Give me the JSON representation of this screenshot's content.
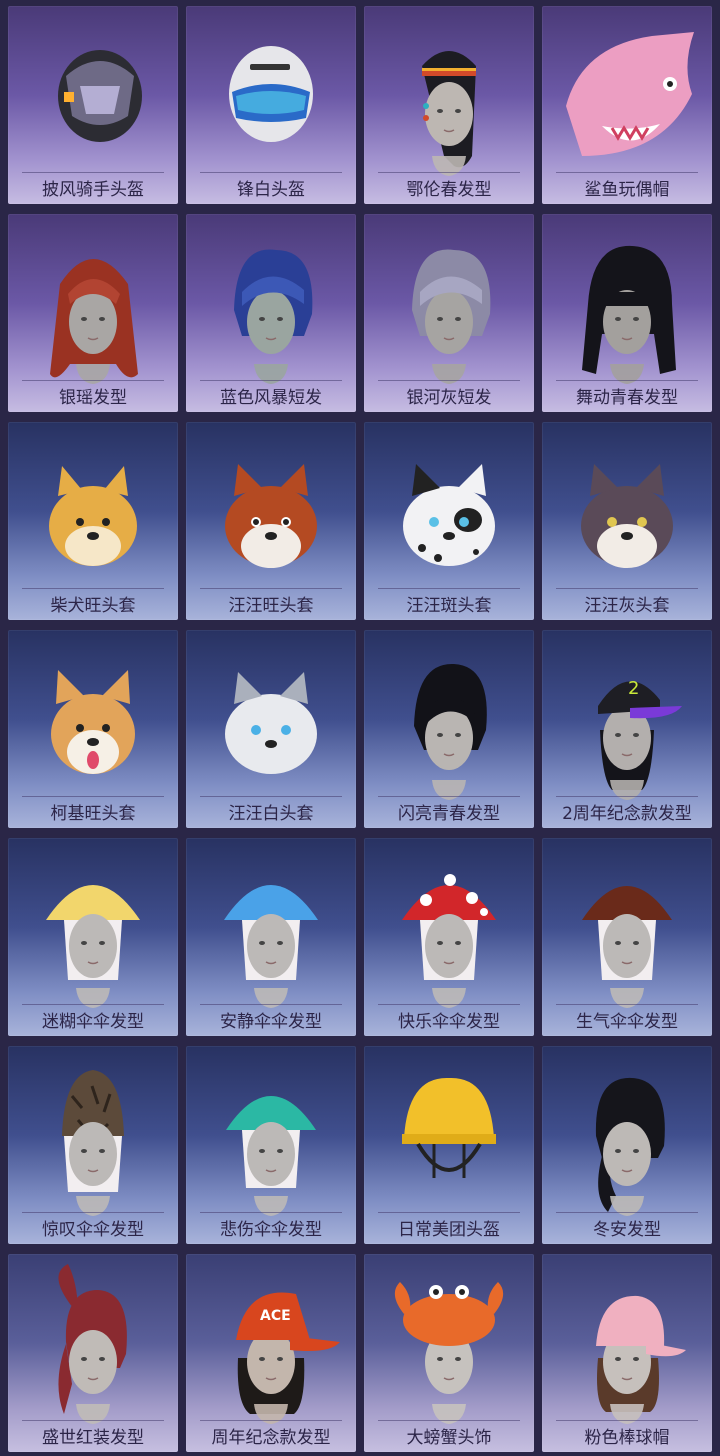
{
  "items": [
    {
      "name": "披风骑手头盔",
      "kind": "helmet-dark",
      "bg": "purple"
    },
    {
      "name": "锋白头盔",
      "kind": "helmet-white",
      "bg": "purple"
    },
    {
      "name": "鄂伦春发型",
      "kind": "hair-braid",
      "bg": "purple"
    },
    {
      "name": "鲨鱼玩偶帽",
      "kind": "shark",
      "bg": "purple"
    },
    {
      "name": "银瑶发型",
      "kind": "hair-long-red",
      "bg": "purple"
    },
    {
      "name": "蓝色风暴短发",
      "kind": "hair-bob-blue",
      "bg": "purple"
    },
    {
      "name": "银河灰短发",
      "kind": "hair-bob-gray",
      "bg": "purple"
    },
    {
      "name": "舞动青春发型",
      "kind": "hair-black-bangs",
      "bg": "purple"
    },
    {
      "name": "柴犬旺头套",
      "kind": "dog-shiba",
      "bg": "blue"
    },
    {
      "name": "汪汪旺头套",
      "kind": "dog-red",
      "bg": "blue"
    },
    {
      "name": "汪汪斑头套",
      "kind": "dog-dalmatian",
      "bg": "blue"
    },
    {
      "name": "汪汪灰头套",
      "kind": "dog-gray",
      "bg": "blue"
    },
    {
      "name": "柯基旺头套",
      "kind": "dog-corgi",
      "bg": "blue"
    },
    {
      "name": "汪汪白头套",
      "kind": "dog-white",
      "bg": "blue"
    },
    {
      "name": "闪亮青春发型",
      "kind": "hair-short-black",
      "bg": "blue"
    },
    {
      "name": "2周年纪念款发型",
      "kind": "cap-purple",
      "bg": "blue"
    },
    {
      "name": "迷糊伞伞发型",
      "kind": "mush-yellow",
      "bg": "blue"
    },
    {
      "name": "安静伞伞发型",
      "kind": "mush-blue",
      "bg": "blue"
    },
    {
      "name": "快乐伞伞发型",
      "kind": "mush-red",
      "bg": "blue"
    },
    {
      "name": "生气伞伞发型",
      "kind": "mush-brown",
      "bg": "blue"
    },
    {
      "name": "惊叹伞伞发型",
      "kind": "mush-morel",
      "bg": "blue"
    },
    {
      "name": "悲伤伞伞发型",
      "kind": "mush-teal",
      "bg": "blue"
    },
    {
      "name": "日常美团头盔",
      "kind": "helmet-yellow",
      "bg": "blue"
    },
    {
      "name": "冬安发型",
      "kind": "hair-black-ponytail",
      "bg": "blue"
    },
    {
      "name": "盛世红装发型",
      "kind": "hair-red-ponytail",
      "bg": "lavender"
    },
    {
      "name": "周年纪念款发型",
      "kind": "cap-orange",
      "bg": "lavender"
    },
    {
      "name": "大螃蟹头饰",
      "kind": "crab",
      "bg": "lavender"
    },
    {
      "name": "粉色棒球帽",
      "kind": "cap-pink",
      "bg": "lavender"
    }
  ],
  "cap_purple_text": "2",
  "cap_orange_text": "ACE"
}
